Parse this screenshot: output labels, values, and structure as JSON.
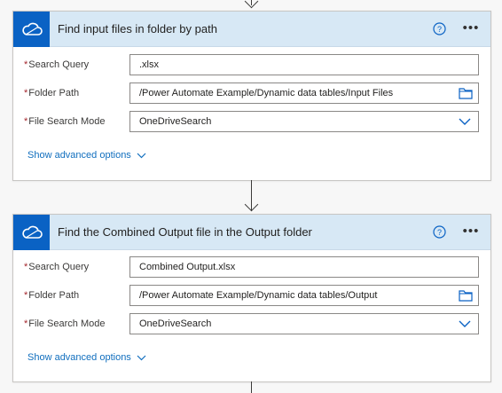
{
  "cards": [
    {
      "title": "Find input files in folder by path",
      "fields": {
        "search_query": {
          "label": "Search Query",
          "value": ".xlsx"
        },
        "folder_path": {
          "label": "Folder Path",
          "value": "/Power Automate Example/Dynamic data tables/Input Files"
        },
        "file_search_mode": {
          "label": "File Search Mode",
          "value": "OneDriveSearch"
        }
      },
      "advanced_label": "Show advanced options"
    },
    {
      "title": "Find the Combined Output file in the Output folder",
      "fields": {
        "search_query": {
          "label": "Search Query",
          "value": "Combined Output.xlsx"
        },
        "folder_path": {
          "label": "Folder Path",
          "value": "/Power Automate Example/Dynamic data tables/Output"
        },
        "file_search_mode": {
          "label": "File Search Mode",
          "value": "OneDriveSearch"
        }
      },
      "advanced_label": "Show advanced options"
    }
  ],
  "required_marker": "*",
  "colors": {
    "connector_blue": "#0a62c4",
    "header_bg": "#d7e8f5",
    "link_blue": "#106ebe",
    "required_red": "#a4262c"
  },
  "icons": {
    "connector": "onedrive-cloud-icon",
    "help": "help-icon",
    "more": "more-options-icon",
    "folder": "folder-icon",
    "dropdown": "chevron-down-icon"
  }
}
